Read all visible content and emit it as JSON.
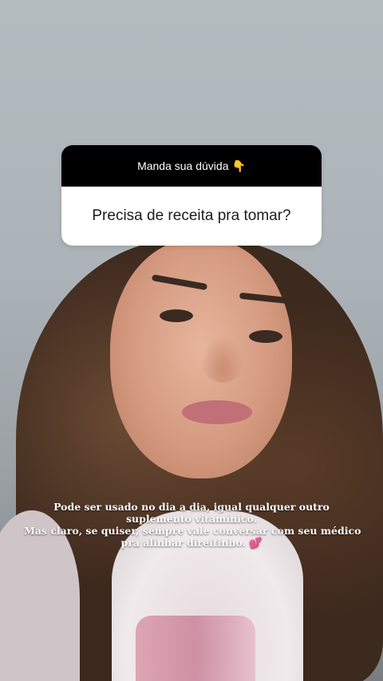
{
  "question_sticker": {
    "header_label": "Manda sua dúvida",
    "header_icon": "pointing-down-icon",
    "header_icon_glyph": "👇",
    "question_text": "Precisa de receita pra tomar?"
  },
  "caption": {
    "line1": "Pode ser usado no dia a dia, igual qualquer outro",
    "line2": "suplemento vitamínico.",
    "line3": "Mas claro, se quiser, sempre vale conversar com seu médico",
    "line4": "pra alinhar direitinho.",
    "trailing_icon": "two-hearts-icon",
    "trailing_icon_glyph": "💕"
  },
  "colors": {
    "sticker_header_bg": "#000000",
    "sticker_body_bg": "#ffffff",
    "caption_text": "#ffffff",
    "heart_color": "#ff5fa2"
  }
}
